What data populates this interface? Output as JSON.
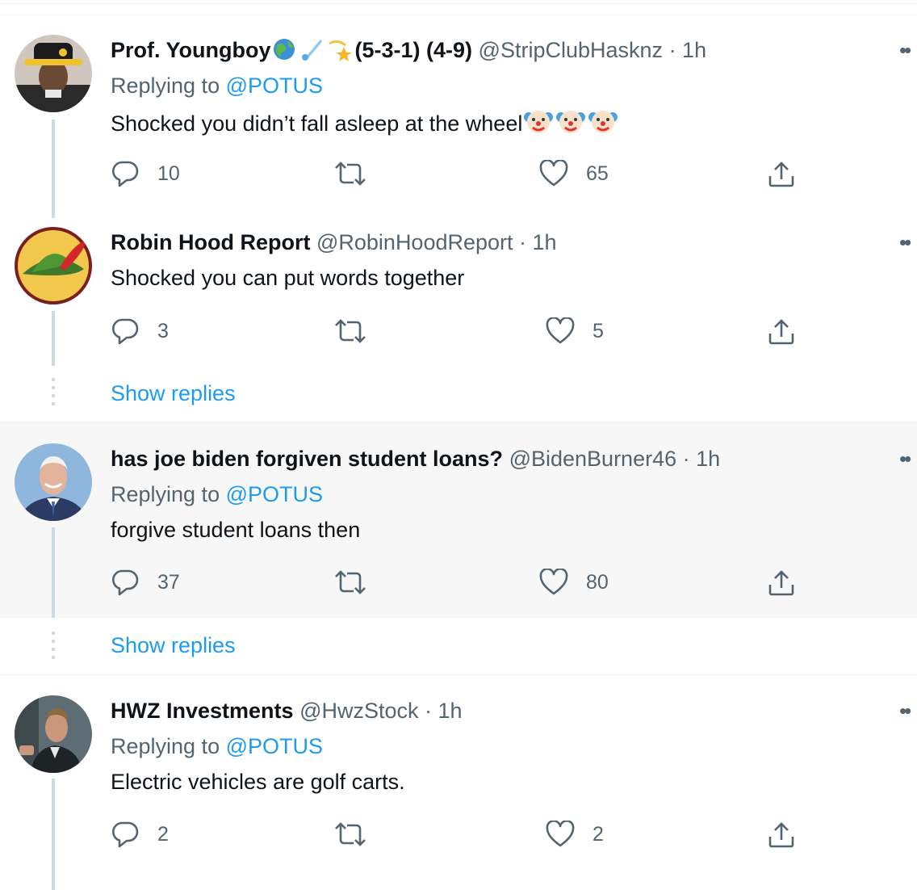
{
  "tweets": [
    {
      "name": "Prof. Youngboy",
      "name_suffix": "(5-3-1) (4-9)",
      "handle": "@StripClubHasknz",
      "time": "· 1h",
      "replying_label": "Replying to",
      "replying_handle": "@POTUS",
      "text": "Shocked you didn’t fall asleep at the wheel",
      "replies": "10",
      "retweets": "",
      "likes": "65"
    },
    {
      "name": "Robin Hood Report",
      "handle": "@RobinHoodReport",
      "time": "· 1h",
      "text": "Shocked you can put words together",
      "replies": "3",
      "retweets": "",
      "likes": "5"
    },
    {
      "name": "has joe biden forgiven student loans?",
      "handle": "@BidenBurner46",
      "time": "· 1h",
      "replying_label": "Replying to",
      "replying_handle": "@POTUS",
      "text": "forgive student loans then",
      "replies": "37",
      "retweets": "",
      "likes": "80"
    },
    {
      "name": "HWZ Investments",
      "handle": "@HwzStock",
      "time": "· 1h",
      "replying_label": "Replying to",
      "replying_handle": "@POTUS",
      "text": "Electric vehicles are golf carts.",
      "replies": "2",
      "retweets": "",
      "likes": "2"
    }
  ],
  "show_replies_label": "Show replies",
  "icons": {
    "reply": "reply-icon",
    "retweet": "retweet-icon",
    "like": "heart-icon",
    "share": "share-icon",
    "more": "more-icon"
  },
  "colors": {
    "link": "#1d9bf0",
    "secondary_text": "#536471",
    "thread_line": "#cfd9de",
    "highlight_bg": "#f7f7f7"
  }
}
